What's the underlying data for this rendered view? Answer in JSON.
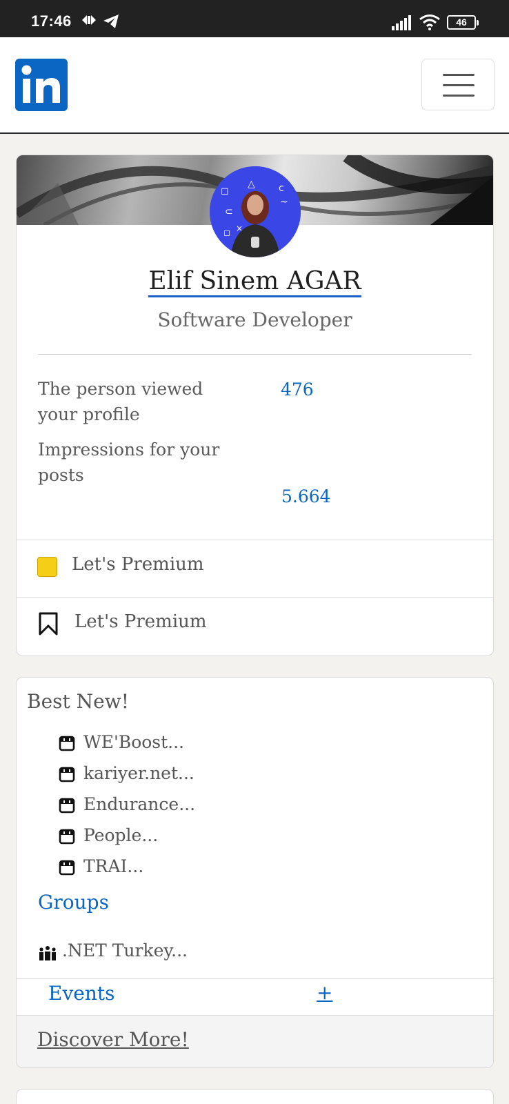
{
  "status_bar": {
    "time": "17:46",
    "battery": "46",
    "icons": [
      "carrier-icon",
      "telegram-icon",
      "signal-icon",
      "wifi-icon",
      "battery-icon"
    ]
  },
  "header": {
    "logo_text": "in",
    "menu_icon": "hamburger-menu-icon"
  },
  "profile": {
    "name": "Elif Sinem AGAR",
    "title": "Software Developer",
    "stats": [
      {
        "label": "The person viewed your profile",
        "value": "476"
      },
      {
        "label": "Impressions for your posts",
        "value": "5.664"
      }
    ],
    "premium_rows": [
      {
        "icon": "premium-square-icon",
        "label": "Let's Premium"
      },
      {
        "icon": "bookmark-icon",
        "label": "Let's Premium"
      }
    ]
  },
  "news": {
    "title": "Best New!",
    "items": [
      "WE'Boost...",
      "kariyer.net...",
      "Endurance...",
      "People...",
      "TRAI..."
    ],
    "groups_label": "Groups",
    "groups": [
      ".NET Turkey..."
    ],
    "events_label": "Events",
    "events_add": "+",
    "discover_label": "Discover More!"
  },
  "colors": {
    "brand": "#0a66c2",
    "status_bar": "#222222",
    "page_bg": "#f3f2ef",
    "premium_yellow": "#f5cf17"
  }
}
